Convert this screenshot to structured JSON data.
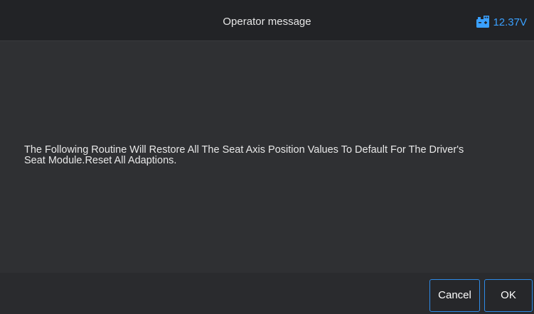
{
  "header": {
    "title": "Operator message",
    "battery_icon": "car-battery-icon",
    "battery_voltage": "12.37V",
    "accent_color": "#3aa0ff"
  },
  "message": {
    "line1": "The Following Routine Will Restore All The Seat Axis Position Values To Default For The Driver's",
    "line2": "Seat Module.Reset All Adaptions."
  },
  "footer": {
    "cancel_label": "Cancel",
    "ok_label": "OK",
    "button_border_color": "#2e8be8"
  }
}
